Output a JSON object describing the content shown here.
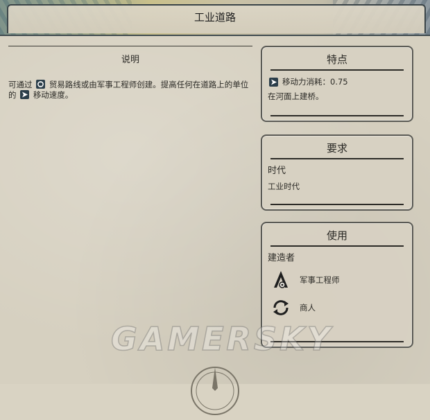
{
  "header": {
    "title": "工业道路"
  },
  "description": {
    "section_title": "说明",
    "text_parts": [
      "可通过",
      "贸易路线或由军事工程师创建。提高任何在道路上的单位的",
      "移动速度。"
    ],
    "trade_icon": "trade-route-icon",
    "movement_icon": "movement-icon"
  },
  "features": {
    "title": "特点",
    "movement_cost": "移动力消耗：0.75",
    "movement_icon": "movement-icon",
    "bridge_text": "在河面上建桥。"
  },
  "requirements": {
    "title": "要求",
    "era_label": "时代",
    "era_value": "工业时代"
  },
  "usage": {
    "title": "使用",
    "builders_label": "建造者",
    "builders": [
      {
        "name": "军事工程师",
        "icon": "military-engineer-icon"
      },
      {
        "name": "商人",
        "icon": "trader-icon"
      }
    ]
  },
  "watermark": "GAMERSKY",
  "colors": {
    "panel_bg": "#d7d1c2",
    "text": "#2b2a26",
    "icon_bg": "#2b3e4a"
  }
}
